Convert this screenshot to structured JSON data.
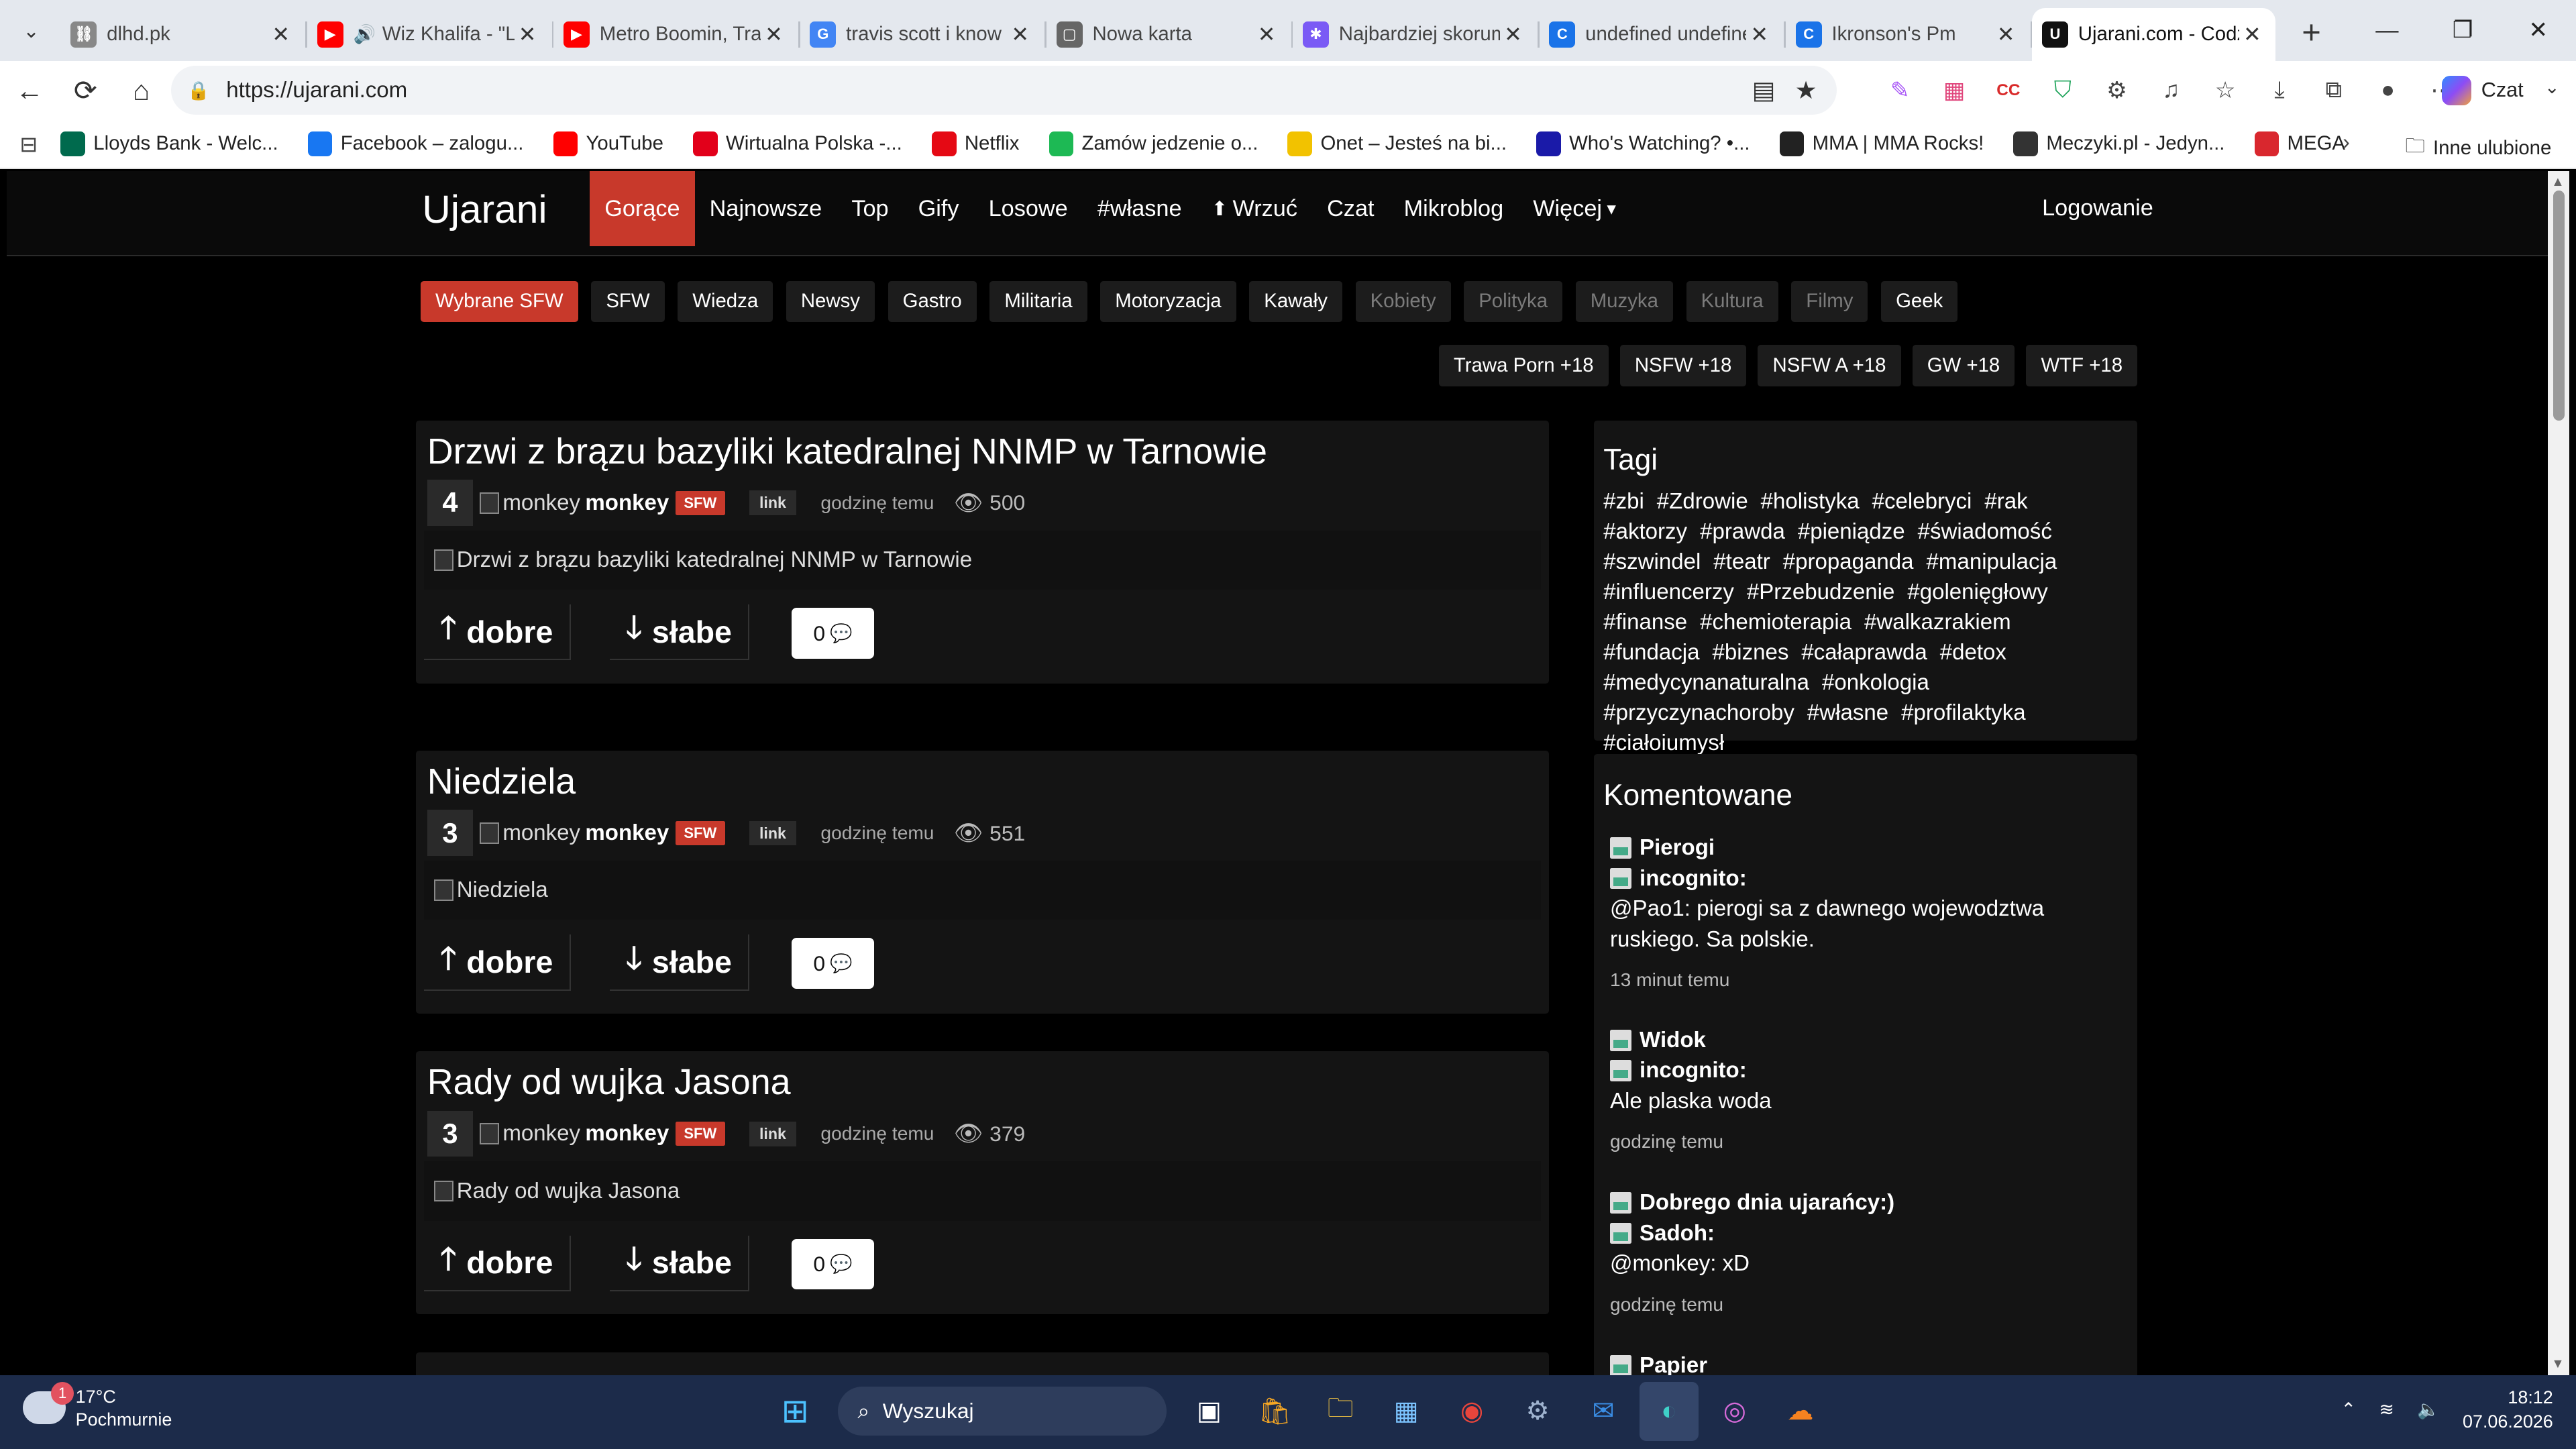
{
  "browser": {
    "tabs": [
      {
        "title": "dlhd.pk",
        "favicon": "link-icon",
        "color": "#888888"
      },
      {
        "title": "Wiz Khalifa - \"L",
        "favicon": "youtube-icon",
        "color": "#ff0000",
        "muted": true
      },
      {
        "title": "Metro Boomin, Trav",
        "favicon": "youtube-icon",
        "color": "#ff0000"
      },
      {
        "title": "travis scott i know",
        "favicon": "google-icon",
        "color": "#4285f4"
      },
      {
        "title": "Nowa karta",
        "favicon": "newtab-icon",
        "color": "#666666"
      },
      {
        "title": "Najbardziej skorum",
        "favicon": "butterfly-icon",
        "color": "#7a5af5"
      },
      {
        "title": "undefined undefine",
        "favicon": "c-icon",
        "color": "#1a73e8"
      },
      {
        "title": "Ikronson's Pm",
        "favicon": "c-icon",
        "color": "#1a73e8"
      },
      {
        "title": "Ujarani.com - Codz",
        "favicon": "u-icon",
        "color": "#111111",
        "active": true
      }
    ],
    "url": "https://ujarani.com",
    "copilot_label": "Czat",
    "favorites": [
      {
        "label": "Lloyds Bank - Welc...",
        "icon": "lloyds-icon",
        "color": "#006a4d"
      },
      {
        "label": "Facebook – zalogu...",
        "icon": "facebook-icon",
        "color": "#1877f2"
      },
      {
        "label": "YouTube",
        "icon": "youtube-icon",
        "color": "#ff0000"
      },
      {
        "label": "Wirtualna Polska -...",
        "icon": "wp-icon",
        "color": "#e2001a"
      },
      {
        "label": "Netflix",
        "icon": "netflix-icon",
        "color": "#e50914"
      },
      {
        "label": "Zamów jedzenie o...",
        "icon": "food-icon",
        "color": "#1db954"
      },
      {
        "label": "Onet – Jesteś na bi...",
        "icon": "onet-icon",
        "color": "#f2c200"
      },
      {
        "label": "Who's Watching? •...",
        "icon": "m-icon",
        "color": "#1a1aa8"
      },
      {
        "label": "MMA | MMA Rocks!",
        "icon": "mma-icon",
        "color": "#222222"
      },
      {
        "label": "Meczyki.pl - Jedyn...",
        "icon": "meczyki-icon",
        "color": "#333333"
      },
      {
        "label": "MEGA",
        "icon": "mega-icon",
        "color": "#d9272e"
      }
    ],
    "other_favorites": "Inne ulubione"
  },
  "site": {
    "brand": "Ujarani",
    "nav": [
      "Gorące",
      "Najnowsze",
      "Top",
      "Gify",
      "Losowe",
      "#własne",
      "Wrzuć",
      "Czat",
      "Mikroblog",
      "Więcej"
    ],
    "login": "Logowanie",
    "categories": [
      {
        "label": "Wybrane SFW",
        "state": "active"
      },
      {
        "label": "SFW",
        "state": "normal"
      },
      {
        "label": "Wiedza",
        "state": "normal"
      },
      {
        "label": "Newsy",
        "state": "normal"
      },
      {
        "label": "Gastro",
        "state": "normal"
      },
      {
        "label": "Militaria",
        "state": "normal"
      },
      {
        "label": "Motoryzacja",
        "state": "normal"
      },
      {
        "label": "Kawały",
        "state": "normal"
      },
      {
        "label": "Kobiety",
        "state": "dim"
      },
      {
        "label": "Polityka",
        "state": "dim"
      },
      {
        "label": "Muzyka",
        "state": "dim"
      },
      {
        "label": "Kultura",
        "state": "dim"
      },
      {
        "label": "Filmy",
        "state": "dim"
      },
      {
        "label": "Geek",
        "state": "normal"
      }
    ],
    "categories_nsfw": [
      "Trawa Porn +18",
      "NSFW +18",
      "NSFW A +18",
      "GW +18",
      "WTF +18"
    ],
    "posts": [
      {
        "title": "Drzwi z brązu bazyliki katedralnej NNMP w Tarnowie",
        "score": "4",
        "avatar_alt": "monkey",
        "user": "monkey",
        "badge": "SFW",
        "type": "link",
        "time": "godzinę temu",
        "views": "500",
        "image_alt": "Drzwi z brązu bazyliki katedralnej NNMP w Tarnowie",
        "up": "dobre",
        "down": "słabe",
        "comments": "0"
      },
      {
        "title": "Niedziela",
        "score": "3",
        "avatar_alt": "monkey",
        "user": "monkey",
        "badge": "SFW",
        "type": "link",
        "time": "godzinę temu",
        "views": "551",
        "image_alt": "Niedziela",
        "up": "dobre",
        "down": "słabe",
        "comments": "0"
      },
      {
        "title": "Rady od wujka Jasona",
        "score": "3",
        "avatar_alt": "monkey",
        "user": "monkey",
        "badge": "SFW",
        "type": "link",
        "time": "godzinę temu",
        "views": "379",
        "image_alt": "Rady od wujka Jasona",
        "up": "dobre",
        "down": "słabe",
        "comments": "0"
      }
    ],
    "tags_title": "Tagi",
    "tags": [
      "#zbi",
      "#Zdrowie",
      "#holistyka",
      "#celebryci",
      "#rak",
      "#aktorzy",
      "#prawda",
      "#pieniądze",
      "#świadomość",
      "#szwindel",
      "#teatr",
      "#propaganda",
      "#manipulacja",
      "#influencerzy",
      "#Przebudzenie",
      "#golenięgłowy",
      "#finanse",
      "#chemioterapia",
      "#walkazrakiem",
      "#fundacja",
      "#biznes",
      "#całaprawda",
      "#detox",
      "#medycynanaturalna",
      "#onkologia",
      "#przyczynachoroby",
      "#własne",
      "#profilaktyka",
      "#ciałoiumysł"
    ],
    "comments_title": "Komentowane",
    "comments": [
      {
        "post": "Pierogi",
        "author": "incognito:",
        "text": "@Pao1: pierogi sa z dawnego wojewodztwa ruskiego. Sa polskie.",
        "time": "13 minut temu"
      },
      {
        "post": "Widok",
        "author": "incognito:",
        "text": "Ale plaska woda",
        "time": "godzinę temu"
      },
      {
        "post": "Dobrego dnia ujarańcy:)",
        "author": "Sadoh:",
        "text": "@monkey: xD",
        "time": "godzinę temu"
      },
      {
        "post": "Papier",
        "author": "",
        "text": "",
        "time": ""
      }
    ]
  },
  "taskbar": {
    "temp": "17°C",
    "weather": "Pochmurnie",
    "badge": "1",
    "search": "Wyszukaj",
    "time": "18:12",
    "date": "07.06.2026"
  }
}
